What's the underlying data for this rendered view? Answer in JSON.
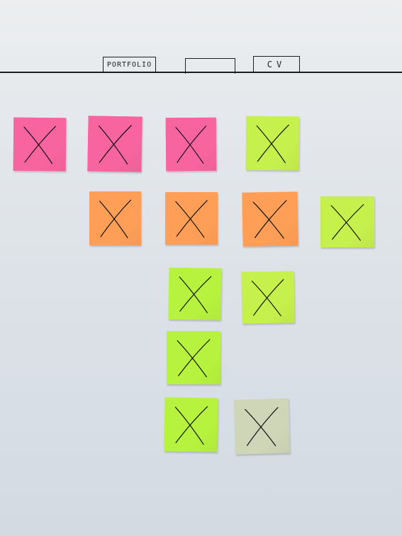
{
  "tabs": {
    "portfolio": "PORTFOLIO",
    "blank": "",
    "cv": "CV"
  },
  "colors": {
    "pink": "#f8649f",
    "orange": "#ff9f57",
    "green": "#c6f04c",
    "lime": "#b7f23e",
    "pale": "#cfd6b8",
    "line": "#1d1d1f"
  },
  "notes": [
    {
      "color": "pink",
      "mark": "x-icon"
    },
    {
      "color": "pink",
      "mark": "x-icon"
    },
    {
      "color": "pink",
      "mark": "x-icon"
    },
    {
      "color": "green",
      "mark": "x-icon"
    },
    {
      "color": "orange",
      "mark": "x-icon"
    },
    {
      "color": "orange",
      "mark": "x-icon"
    },
    {
      "color": "orange",
      "mark": "x-icon"
    },
    {
      "color": "green",
      "mark": "x-icon"
    },
    {
      "color": "lime",
      "mark": "x-icon"
    },
    {
      "color": "green",
      "mark": "x-icon"
    },
    {
      "color": "lime",
      "mark": "x-icon"
    },
    {
      "color": "lime",
      "mark": "x-icon"
    },
    {
      "color": "pale",
      "mark": "x-icon"
    }
  ]
}
